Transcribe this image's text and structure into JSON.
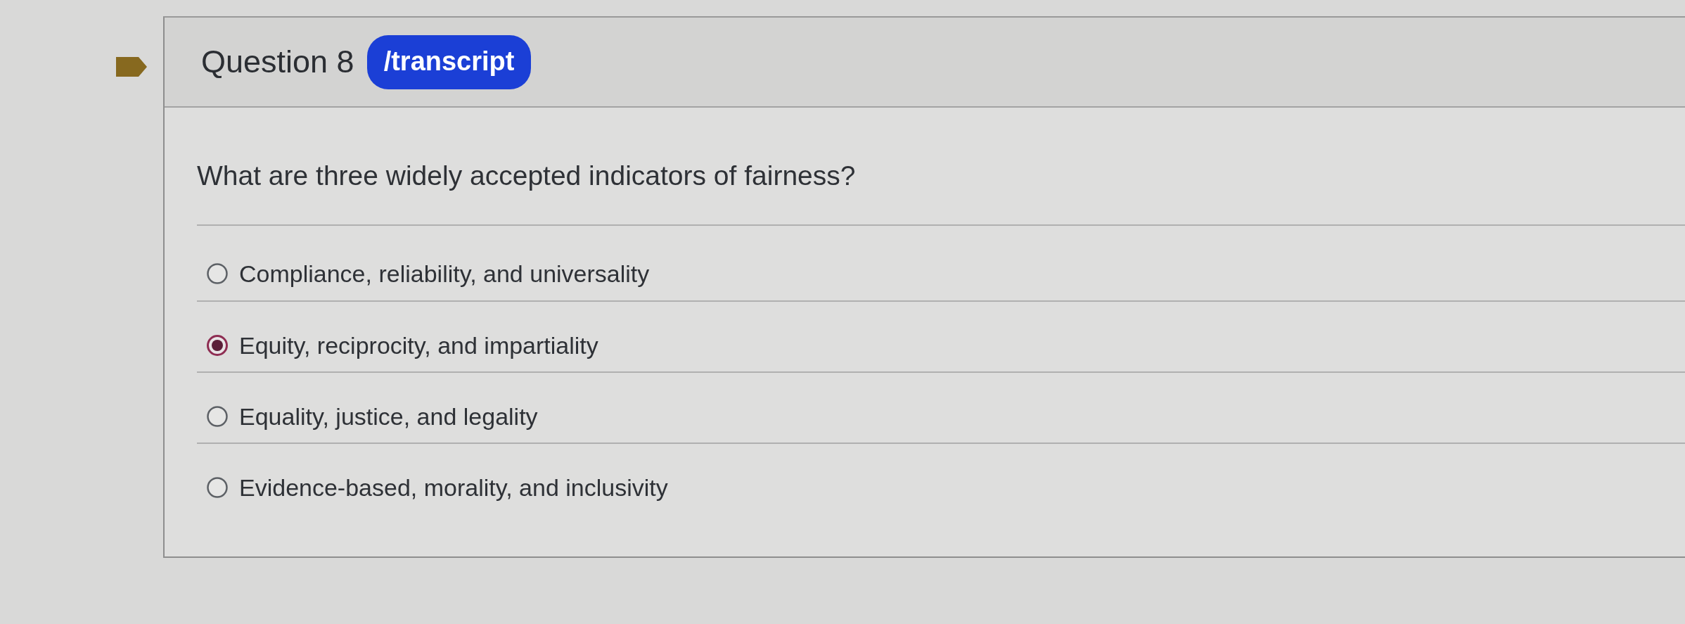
{
  "question_header": {
    "title": "Question 8",
    "badge": "/transcript"
  },
  "question": {
    "prompt": "What are three widely accepted indicators of fairness?"
  },
  "options": [
    {
      "label": "Compliance, reliability, and universality",
      "selected": false
    },
    {
      "label": "Equity, reciprocity, and impartiality",
      "selected": true
    },
    {
      "label": "Equality, justice, and legality",
      "selected": false
    },
    {
      "label": "Evidence-based, morality, and inclusivity",
      "selected": false
    }
  ]
}
